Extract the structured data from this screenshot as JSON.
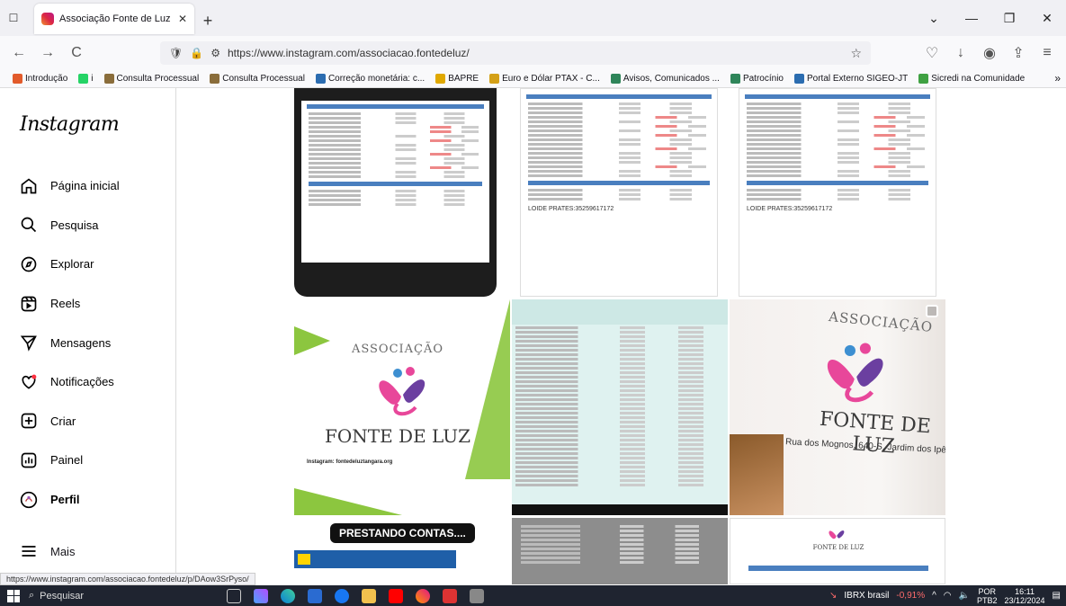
{
  "browser": {
    "tab_title": "Associação Fonte de Luz (@ass",
    "tab_close": "✕",
    "new_tab": "+",
    "url": "https://www.instagram.com/associacao.fontedeluz/",
    "status_url": "https://www.instagram.com/associacao.fontedeluz/p/DAow3SrPyso/",
    "window_controls": {
      "dropdown": "⌄",
      "minimize": "—",
      "restore": "❐",
      "close": "✕"
    },
    "nav": {
      "back": "←",
      "forward": "→",
      "reload": "C"
    },
    "bookmarks": [
      {
        "label": "Introdução",
        "color": "#e25b2b"
      },
      {
        "label": "i",
        "color": "#25d366"
      },
      {
        "label": "Consulta Processual",
        "color": "#8a6d3b"
      },
      {
        "label": "Consulta Processual",
        "color": "#8a6d3b"
      },
      {
        "label": "Correção monetária: c...",
        "color": "#2b6cb0"
      },
      {
        "label": "BAPRE",
        "color": "#e0a800"
      },
      {
        "label": "Euro e Dólar PTAX - C...",
        "color": "#d4a017"
      },
      {
        "label": "Avisos, Comunicados ...",
        "color": "#2f855a"
      },
      {
        "label": "Patrocínio",
        "color": "#2f855a"
      },
      {
        "label": "Portal Externo SIGEO-JT",
        "color": "#2b6cb0"
      },
      {
        "label": "Sicredi na Comunidade",
        "color": "#3fa142"
      }
    ],
    "bookmarks_more": "»"
  },
  "instagram": {
    "logo": "Instagram",
    "menu": [
      {
        "label": "Página inicial",
        "icon": "home-icon"
      },
      {
        "label": "Pesquisa",
        "icon": "search-icon"
      },
      {
        "label": "Explorar",
        "icon": "compass-icon"
      },
      {
        "label": "Reels",
        "icon": "reels-icon"
      },
      {
        "label": "Mensagens",
        "icon": "send-icon"
      },
      {
        "label": "Notificações",
        "icon": "heart-icon"
      },
      {
        "label": "Criar",
        "icon": "plus-square-icon"
      },
      {
        "label": "Painel",
        "icon": "chart-icon"
      },
      {
        "label": "Perfil",
        "icon": "avatar"
      }
    ],
    "more_label": "Mais",
    "posts": {
      "doc_name_1": "LOIDE PRATES:35259617172",
      "doc_name_2": "LOIDE PRATES:35259617172",
      "logo1_assoc": "ASSOCIAÇÃO",
      "logo1_fonte": "FONTE DE LUZ",
      "logo1_insta": "Instagram: fontedeluztangara.org",
      "logo2_assoc": "ASSOCIAÇÃO",
      "logo2_fonte": "FONTE DE LUZ",
      "logo2_address": "Rua dos Mognos, 640-S, Jardim dos Ipês",
      "prestando": "PRESTANDO CONTAS....",
      "small_logo": "FONTE DE LUZ"
    }
  },
  "taskbar": {
    "search": "Pesquisar",
    "ibrx_label": "IBRX brasil",
    "ibrx_change": "-0,91%",
    "lang": "POR",
    "lang_sub": "PTB2",
    "time": "16:11",
    "date": "23/12/2024"
  }
}
